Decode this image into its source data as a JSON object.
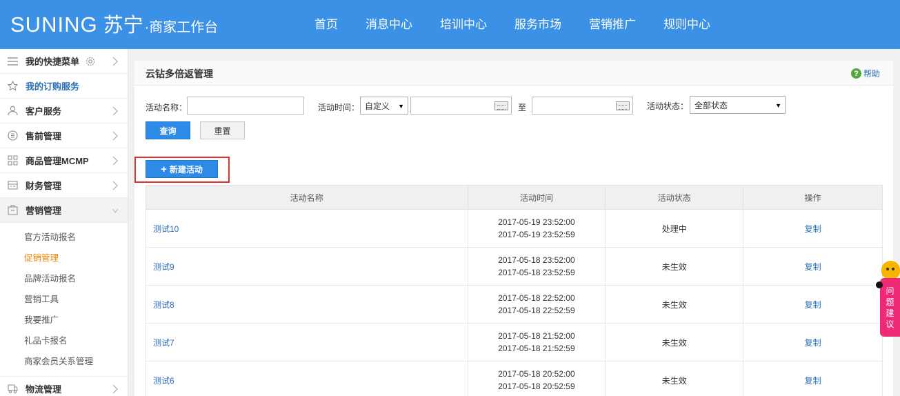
{
  "header": {
    "logo_main": "SUNING",
    "logo_cn": "苏宁",
    "logo_sub": "·商家工作台",
    "nav": [
      "首页",
      "消息中心",
      "培训中心",
      "服务市场",
      "营销推广",
      "规则中心"
    ]
  },
  "sidebar": {
    "items_top": [
      {
        "label": "我的快捷菜单",
        "icon": "menu-icon"
      },
      {
        "label": "我的订购服务",
        "icon": "star-icon"
      },
      {
        "label": "客户服务",
        "icon": "user-icon"
      },
      {
        "label": "售前管理",
        "icon": "presale-icon"
      },
      {
        "label": "商品管理MCMP",
        "icon": "grid-icon"
      },
      {
        "label": "财务管理",
        "icon": "finance-icon"
      },
      {
        "label": "营销管理",
        "icon": "marketing-icon"
      }
    ],
    "sub_items": [
      "官方活动报名",
      "促销管理",
      "品牌活动报名",
      "营销工具",
      "我要推广",
      "礼品卡报名",
      "商家会员关系管理"
    ],
    "items_bottom": [
      {
        "label": "物流管理",
        "icon": "logistics-icon"
      }
    ]
  },
  "main": {
    "title": "云钻多倍返管理",
    "help_label": "帮助",
    "filters": {
      "name_label": "活动名称：",
      "name_value": "",
      "time_label": "活动时间：",
      "time_mode": "自定义",
      "start_value": "",
      "to_label": "至",
      "end_value": "",
      "status_label": "活动状态：",
      "status_value": "全部状态"
    },
    "query_label": "查询",
    "reset_label": "重置",
    "new_label": "新建活动"
  },
  "table": {
    "columns": [
      "活动名称",
      "活动时间",
      "活动状态",
      "操作"
    ],
    "rows": [
      {
        "name": "测试10",
        "start": "2017-05-19 23:52:00",
        "end": "2017-05-19 23:52:59",
        "status": "处理中",
        "op": "复制"
      },
      {
        "name": "测试9",
        "start": "2017-05-18 23:52:00",
        "end": "2017-05-18 23:52:59",
        "status": "未生效",
        "op": "复制"
      },
      {
        "name": "测试8",
        "start": "2017-05-18 22:52:00",
        "end": "2017-05-18 22:52:59",
        "status": "未生效",
        "op": "复制"
      },
      {
        "name": "测试7",
        "start": "2017-05-18 21:52:00",
        "end": "2017-05-18 21:52:59",
        "status": "未生效",
        "op": "复制"
      },
      {
        "name": "测试6",
        "start": "2017-05-18 20:52:00",
        "end": "2017-05-18 20:52:59",
        "status": "未生效",
        "op": "复制"
      }
    ]
  },
  "feedback": {
    "chars": [
      "问",
      "题",
      "建",
      "议"
    ]
  },
  "colors": {
    "header_blue": "#3a91e6",
    "link_blue": "#2a6fb6",
    "accent_orange": "#f08300",
    "button_blue": "#2d8ae6",
    "highlight_red": "#e03030",
    "feedback_pink": "#ee2a77"
  }
}
